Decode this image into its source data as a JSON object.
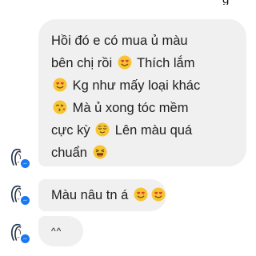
{
  "messages": [
    {
      "lines": [
        {
          "before": "Hồi đó e có mua ủ màu",
          "emoji": "",
          "after": ""
        },
        {
          "before": "bên chị rồi ",
          "emoji": "smiling-hearts-emoji",
          "after": " Thích lắm"
        },
        {
          "before": "",
          "emoji": "smiling-hearts-emoji",
          "after": " Kg như mấy loại khác"
        },
        {
          "before": "",
          "emoji": "kissing-heart-emoji",
          "after": " Mà ủ xong tóc mềm"
        },
        {
          "before": "cực kỳ ",
          "emoji": "relieved-emoji",
          "after": " Lên màu quá"
        },
        {
          "before": "chuẩn ",
          "emoji": "laughing-emoji",
          "after": ""
        }
      ]
    },
    {
      "text": "Màu nâu tn á",
      "emojis": [
        "smiling-hearts-emoji",
        "smiling-hearts-emoji"
      ]
    },
    {
      "text": "^^"
    }
  ],
  "colors": {
    "bubble": "#f0f0f0",
    "text": "#1e1e1e",
    "badge": "#1877f2",
    "emoji_face": "#f7c531"
  }
}
